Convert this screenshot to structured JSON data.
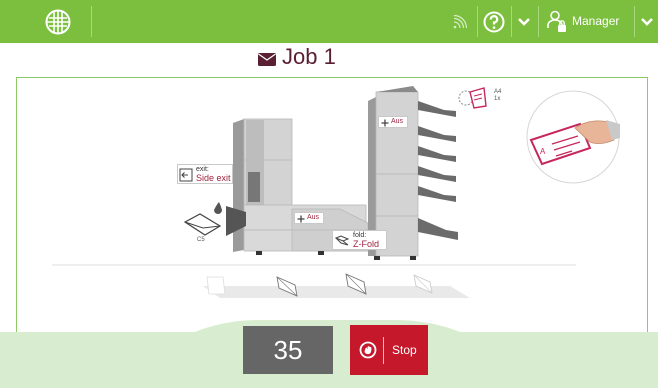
{
  "topbar": {
    "logo_icon": "globe-grid-icon",
    "signal_icon": "signal-icon",
    "help_icon": "help-icon",
    "chevron_icon": "chevron-down-icon",
    "user_icon": "user-lock-icon",
    "user_label": "Manager",
    "color": "#7cbf3f"
  },
  "job": {
    "icon": "envelope-icon",
    "title": "Job 1"
  },
  "machine": {
    "exit_label": "exit:",
    "exit_value": "Side exit",
    "fold_label": "fold:",
    "fold_value": "Z-Fold",
    "upper_station": "Aus",
    "lower_station": "Aus",
    "envelope_size": "C5",
    "doc_size": "A4",
    "doc_count": "1x"
  },
  "controls": {
    "counter": "35",
    "stop_label": "Stop",
    "stop_icon": "stop-hand-icon",
    "stop_color": "#c6182b"
  }
}
